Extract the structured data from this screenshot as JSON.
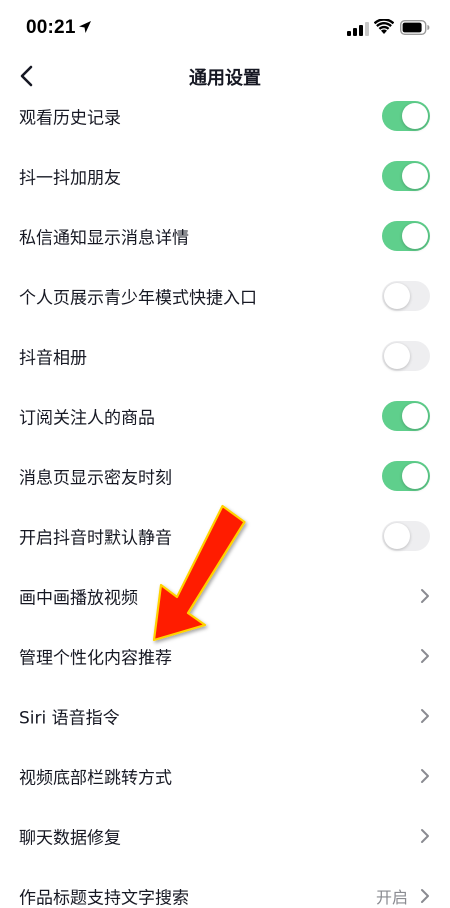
{
  "status_bar": {
    "time": "00:21",
    "icons": [
      "location-arrow-icon",
      "signal-icon",
      "wifi-icon",
      "battery-icon"
    ]
  },
  "nav": {
    "title": "通用设置",
    "back_icon": "chevron-left-icon"
  },
  "colors": {
    "toggle_on": "#5fcf8c",
    "toggle_off": "#eeeef0",
    "text": "#161823",
    "secondary_text": "#8a8b91",
    "arrow": "#ff1a00",
    "arrow_outline": "#ffd200"
  },
  "settings": [
    {
      "label": "观看历史记录",
      "control": "toggle",
      "on": true
    },
    {
      "label": "抖一抖加朋友",
      "control": "toggle",
      "on": true
    },
    {
      "label": "私信通知显示消息详情",
      "control": "toggle",
      "on": true
    },
    {
      "label": "个人页展示青少年模式快捷入口",
      "control": "toggle",
      "on": false
    },
    {
      "label": "抖音相册",
      "control": "toggle",
      "on": false
    },
    {
      "label": "订阅关注人的商品",
      "control": "toggle",
      "on": true
    },
    {
      "label": "消息页显示密友时刻",
      "control": "toggle",
      "on": true
    },
    {
      "label": "开启抖音时默认静音",
      "control": "toggle",
      "on": false
    },
    {
      "label": "画中画播放视频",
      "control": "chevron"
    },
    {
      "label": "管理个性化内容推荐",
      "control": "chevron"
    },
    {
      "label": "Siri 语音指令",
      "control": "chevron"
    },
    {
      "label": "视频底部栏跳转方式",
      "control": "chevron"
    },
    {
      "label": "聊天数据修复",
      "control": "chevron"
    },
    {
      "label": "作品标题支持文字搜索",
      "control": "chevron",
      "value": "开启"
    }
  ]
}
